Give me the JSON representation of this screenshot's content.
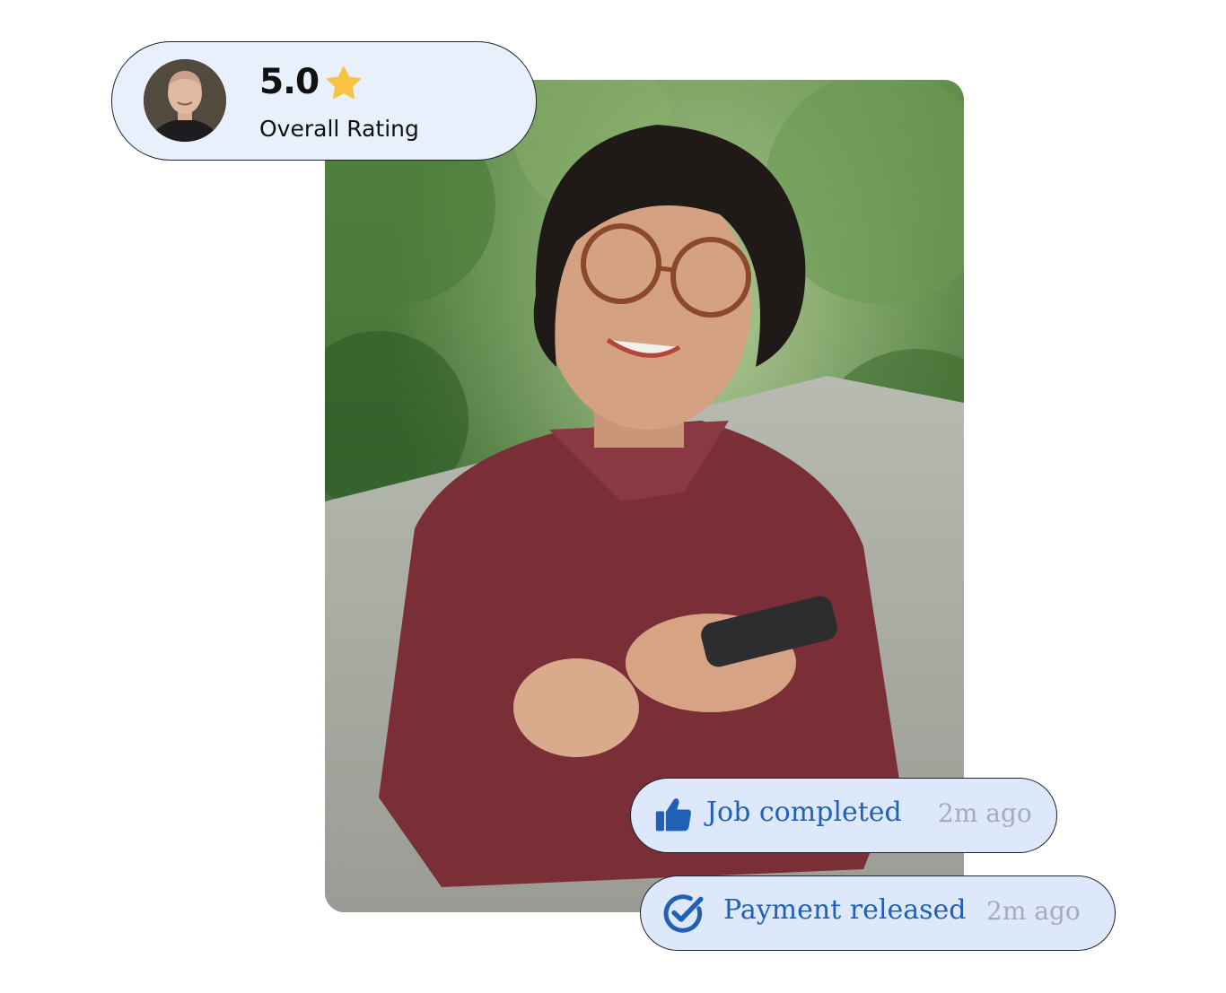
{
  "rating_card": {
    "value": "5.0",
    "label": "Overall Rating",
    "star_icon": "star-icon",
    "star_color": "#f6c343"
  },
  "notifications": [
    {
      "icon": "thumbs-up-icon",
      "label": "Job completed",
      "time": "2m ago"
    },
    {
      "icon": "check-circle-icon",
      "label": "Payment released",
      "time": "2m ago"
    }
  ],
  "colors": {
    "card_background": "#e8f0fc",
    "pill_background": "#dde8fb",
    "accent_blue": "#2160b5",
    "muted_text": "#a6acb7"
  }
}
